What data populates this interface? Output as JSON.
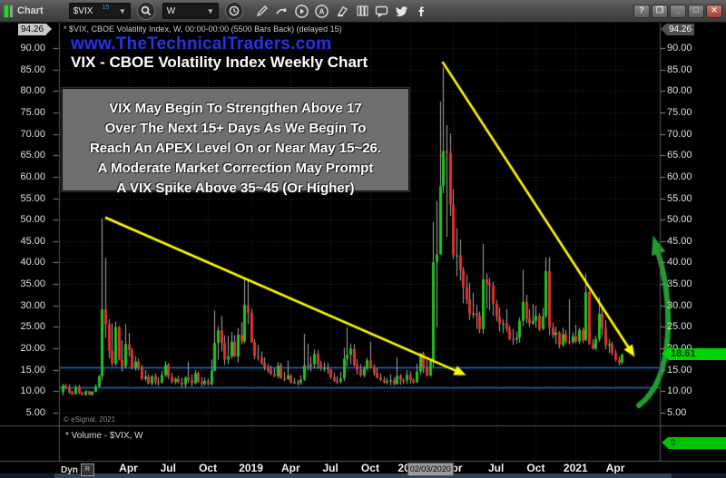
{
  "toolbar": {
    "tab_label": "Chart",
    "symbol_value": "$VIX",
    "symbol_badge": "15",
    "interval_value": "W",
    "window_buttons": {
      "help": "?",
      "minimize": "_",
      "close": "x"
    }
  },
  "chart_header": {
    "info_line": "* $VIX, CBOE Volatility Index, W, 00:00-00:00 (5500 Bars Back) (delayed 15)",
    "link": "www.TheTechnicalTraders.com",
    "title": "VIX - CBOE Volatility Index Weekly Chart"
  },
  "annotation_box": {
    "lines": [
      "VIX May Begin To Strengthen Above 17",
      "Over The Next 15+ Days As We Begin To",
      "Reach An APEX Level On or Near May 15~26.",
      "A Moderate Market Correction May Prompt",
      "A VIX Spike Above 35~45 (Or Higher)"
    ]
  },
  "price_axis": {
    "high_label": "94.26",
    "last_label": "18.61"
  },
  "volume_panel": {
    "label": "* Volume - $VIX, W",
    "last_label": "0"
  },
  "footer": {
    "dyn_label": "Dyn",
    "date_marker": "02/03/2020"
  },
  "copyright": "© eSignal, 2021",
  "chart_data": {
    "type": "candlestick",
    "symbol": "$VIX",
    "interval": "W",
    "title": "VIX - CBOE Volatility Index Weekly Chart",
    "ylim": [
      5,
      90
    ],
    "ytick_step": 5,
    "high_marker": 94.26,
    "last_close": 18.61,
    "grid": true,
    "colors": {
      "up": "#1fc421",
      "down": "#e33030",
      "wick": "#a8a8a8",
      "trendline": "#ffff00",
      "momentum_arrow": "#1f9e2e",
      "support": "#1d6fc0",
      "tag": "#00d400"
    },
    "x_ticks": [
      {
        "label": "Apr",
        "week": 20
      },
      {
        "label": "Jul",
        "week": 32
      },
      {
        "label": "Oct",
        "week": 44
      },
      {
        "label": "2019",
        "week": 57
      },
      {
        "label": "Apr",
        "week": 69
      },
      {
        "label": "Jul",
        "week": 81
      },
      {
        "label": "Oct",
        "week": 93
      },
      {
        "label": "2020",
        "week": 105
      },
      {
        "label": "Apr",
        "week": 118
      },
      {
        "label": "Jul",
        "week": 131
      },
      {
        "label": "Oct",
        "week": 143
      },
      {
        "label": "2021",
        "week": 155
      },
      {
        "label": "Apr",
        "week": 167
      }
    ],
    "date_marker_week": 105,
    "support_lines": [
      {
        "price": 15.6,
        "color": "#1d6fc0"
      },
      {
        "price": 11.0,
        "color": "#1d6fc0"
      }
    ],
    "trendlines": [
      {
        "x1_week": 13.0,
        "p1": 50.5,
        "x2_week": 119.7,
        "p2": 14.5,
        "color": "#ffff00"
      },
      {
        "x1_week": 114.8,
        "p1": 86.8,
        "x2_week": 171.5,
        "p2": 19.6,
        "color": "#ffff00"
      }
    ],
    "green_arrow": {
      "start": [
        704,
        447
      ],
      "c1": [
        745,
        416
      ],
      "c2": [
        741,
        330
      ],
      "end": [
        724,
        274
      ],
      "color": "#1f9e2e"
    },
    "candles": [
      [
        9.8,
        11.7,
        9.0,
        11.3
      ],
      [
        11.3,
        11.8,
        10.4,
        10.7
      ],
      [
        10.7,
        11.6,
        9.4,
        9.7
      ],
      [
        9.7,
        10.1,
        9.1,
        9.3
      ],
      [
        9.3,
        11.4,
        9.2,
        11.0
      ],
      [
        11.0,
        11.5,
        9.3,
        9.6
      ],
      [
        9.6,
        9.9,
        9.0,
        9.2
      ],
      [
        9.2,
        10.2,
        8.9,
        10.0
      ],
      [
        10.0,
        10.1,
        9.0,
        9.2
      ],
      [
        9.2,
        10.0,
        8.9,
        9.9
      ],
      [
        9.9,
        11.6,
        9.8,
        11.1
      ],
      [
        11.1,
        13.8,
        10.9,
        13.5
      ],
      [
        13.5,
        50.3,
        12.5,
        29.1
      ],
      [
        29.1,
        41.1,
        22.4,
        25.6
      ],
      [
        25.6,
        26.8,
        17.7,
        19.5
      ],
      [
        19.5,
        25.8,
        15.9,
        16.5
      ],
      [
        16.5,
        26.2,
        15.9,
        24.9
      ],
      [
        24.9,
        25.3,
        17.2,
        17.4
      ],
      [
        17.4,
        21.9,
        14.6,
        15.8
      ],
      [
        15.8,
        25.7,
        15.3,
        21.0
      ],
      [
        21.0,
        23.6,
        18.1,
        19.6
      ],
      [
        19.6,
        20.1,
        15.1,
        15.4
      ],
      [
        15.4,
        18.2,
        14.8,
        16.9
      ],
      [
        16.9,
        17.6,
        14.9,
        15.4
      ],
      [
        15.4,
        16.2,
        12.6,
        12.9
      ],
      [
        12.9,
        14.9,
        12.4,
        13.4
      ],
      [
        13.4,
        14.0,
        11.6,
        11.8
      ],
      [
        11.8,
        13.8,
        11.3,
        13.5
      ],
      [
        13.5,
        14.1,
        11.5,
        12.2
      ],
      [
        12.2,
        13.3,
        11.2,
        12.0
      ],
      [
        12.0,
        14.7,
        11.8,
        13.8
      ],
      [
        13.8,
        17.0,
        13.3,
        16.1
      ],
      [
        16.1,
        16.6,
        12.9,
        13.4
      ],
      [
        13.4,
        14.3,
        11.8,
        12.2
      ],
      [
        12.2,
        13.2,
        11.6,
        12.9
      ],
      [
        12.9,
        13.6,
        11.9,
        12.1
      ],
      [
        12.1,
        13.2,
        10.9,
        11.6
      ],
      [
        11.6,
        13.5,
        10.8,
        13.2
      ],
      [
        13.2,
        16.9,
        12.0,
        12.6
      ],
      [
        12.6,
        13.9,
        11.1,
        11.9
      ],
      [
        11.9,
        14.9,
        11.6,
        14.2
      ],
      [
        14.2,
        14.6,
        12.1,
        12.1
      ],
      [
        12.1,
        13.3,
        11.1,
        11.7
      ],
      [
        11.7,
        13.2,
        11.3,
        12.4
      ],
      [
        12.4,
        13.0,
        11.3,
        11.6
      ],
      [
        11.6,
        17.4,
        11.3,
        14.8
      ],
      [
        14.8,
        28.8,
        14.6,
        21.3
      ],
      [
        21.3,
        25.2,
        17.3,
        24.2
      ],
      [
        24.2,
        27.5,
        19.3,
        21.3
      ],
      [
        21.3,
        23.0,
        16.1,
        17.4
      ],
      [
        17.4,
        22.9,
        16.3,
        18.1
      ],
      [
        18.1,
        23.8,
        17.6,
        21.5
      ],
      [
        21.5,
        23.1,
        18.0,
        18.1
      ],
      [
        18.1,
        24.7,
        16.7,
        23.2
      ],
      [
        23.2,
        26.1,
        20.9,
        21.6
      ],
      [
        21.6,
        36.2,
        21.2,
        30.1
      ],
      [
        30.1,
        36.1,
        25.6,
        28.3
      ],
      [
        28.3,
        29.2,
        21.4,
        21.4
      ],
      [
        21.4,
        22.1,
        17.5,
        18.2
      ],
      [
        18.2,
        20.8,
        17.1,
        17.8
      ],
      [
        17.8,
        19.3,
        16.2,
        16.6
      ],
      [
        16.6,
        17.9,
        14.9,
        15.7
      ],
      [
        15.7,
        16.4,
        14.3,
        14.9
      ],
      [
        14.9,
        16.0,
        13.7,
        14.0
      ],
      [
        14.0,
        15.4,
        13.3,
        13.5
      ],
      [
        13.5,
        16.9,
        13.0,
        16.0
      ],
      [
        16.0,
        16.6,
        12.9,
        13.0
      ],
      [
        13.0,
        14.5,
        12.3,
        12.9
      ],
      [
        12.9,
        17.1,
        12.6,
        13.7
      ],
      [
        13.7,
        14.0,
        11.8,
        12.0
      ],
      [
        12.0,
        13.1,
        11.7,
        12.1
      ],
      [
        12.1,
        12.7,
        11.3,
        12.0
      ],
      [
        12.0,
        13.7,
        11.5,
        12.7
      ],
      [
        12.7,
        23.4,
        12.4,
        16.0
      ],
      [
        16.0,
        21.1,
        14.9,
        15.9
      ],
      [
        15.9,
        18.1,
        14.6,
        16.3
      ],
      [
        16.3,
        19.7,
        15.3,
        18.7
      ],
      [
        18.7,
        19.6,
        15.2,
        16.3
      ],
      [
        16.3,
        17.1,
        14.8,
        15.4
      ],
      [
        15.4,
        16.7,
        14.5,
        15.4
      ],
      [
        15.4,
        16.6,
        14.0,
        15.1
      ],
      [
        15.1,
        15.2,
        12.8,
        13.3
      ],
      [
        13.3,
        14.3,
        12.2,
        12.4
      ],
      [
        12.4,
        13.5,
        11.7,
        12.2
      ],
      [
        12.2,
        14.5,
        11.8,
        13.0
      ],
      [
        13.0,
        20.1,
        12.4,
        17.6
      ],
      [
        17.6,
        24.8,
        15.8,
        18.5
      ],
      [
        18.5,
        21.1,
        16.3,
        19.9
      ],
      [
        19.9,
        21.0,
        15.8,
        16.1
      ],
      [
        16.1,
        17.5,
        13.9,
        15.0
      ],
      [
        15.0,
        16.3,
        13.3,
        13.7
      ],
      [
        13.7,
        15.9,
        13.2,
        15.3
      ],
      [
        15.3,
        17.8,
        14.9,
        17.2
      ],
      [
        17.2,
        21.5,
        15.4,
        15.7
      ],
      [
        15.7,
        16.3,
        13.6,
        14.2
      ],
      [
        14.2,
        15.4,
        12.9,
        13.2
      ],
      [
        13.2,
        14.1,
        12.3,
        12.6
      ],
      [
        12.6,
        13.4,
        11.8,
        12.1
      ],
      [
        12.1,
        13.1,
        11.6,
        12.3
      ],
      [
        12.3,
        13.9,
        11.4,
        12.6
      ],
      [
        12.6,
        13.2,
        11.3,
        11.7
      ],
      [
        11.7,
        18.0,
        11.5,
        13.6
      ],
      [
        13.6,
        14.0,
        11.5,
        12.6
      ],
      [
        12.6,
        13.0,
        11.7,
        12.5
      ],
      [
        12.5,
        14.9,
        11.7,
        13.8
      ],
      [
        13.8,
        14.6,
        11.8,
        12.6
      ],
      [
        12.6,
        13.0,
        11.7,
        12.1
      ],
      [
        12.1,
        16.4,
        11.9,
        14.6
      ],
      [
        14.6,
        19.0,
        13.9,
        18.8
      ],
      [
        18.8,
        19.2,
        14.2,
        15.5
      ],
      [
        15.5,
        17.3,
        13.4,
        13.7
      ],
      [
        13.7,
        17.1,
        13.4,
        17.1
      ],
      [
        17.1,
        49.5,
        15.6,
        40.1
      ],
      [
        40.1,
        54.4,
        24.9,
        41.9
      ],
      [
        41.9,
        77.6,
        41.8,
        57.8
      ],
      [
        57.8,
        85.5,
        56.1,
        66.0
      ],
      [
        66.0,
        72.0,
        46.0,
        65.5
      ],
      [
        65.5,
        70.0,
        50.9,
        53.5
      ],
      [
        53.5,
        57.1,
        40.8,
        41.7
      ],
      [
        41.7,
        48.0,
        36.8,
        41.7
      ],
      [
        41.7,
        45.4,
        35.8,
        38.2
      ],
      [
        38.2,
        39.0,
        30.5,
        34.2
      ],
      [
        34.2,
        37.2,
        30.3,
        31.4
      ],
      [
        31.4,
        35.3,
        26.6,
        28.0
      ],
      [
        28.0,
        33.0,
        27.0,
        28.2
      ],
      [
        28.2,
        30.1,
        24.5,
        27.5
      ],
      [
        27.5,
        28.6,
        23.5,
        24.5
      ],
      [
        24.5,
        44.4,
        23.3,
        36.1
      ],
      [
        36.1,
        37.5,
        29.3,
        35.1
      ],
      [
        35.1,
        36.4,
        28.9,
        34.7
      ],
      [
        34.7,
        35.5,
        27.6,
        30.4
      ],
      [
        30.4,
        31.3,
        26.3,
        27.3
      ],
      [
        27.3,
        29.5,
        23.9,
        25.7
      ],
      [
        25.7,
        26.8,
        23.5,
        25.8
      ],
      [
        25.8,
        29.2,
        23.8,
        24.5
      ],
      [
        24.5,
        25.3,
        21.9,
        22.2
      ],
      [
        22.2,
        24.5,
        20.8,
        22.1
      ],
      [
        22.1,
        23.9,
        21.1,
        22.5
      ],
      [
        22.5,
        27.2,
        21.3,
        26.4
      ],
      [
        26.4,
        38.3,
        25.2,
        30.8
      ],
      [
        30.8,
        32.5,
        25.9,
        26.9
      ],
      [
        26.9,
        29.1,
        25.0,
        25.8
      ],
      [
        25.8,
        30.3,
        25.4,
        26.4
      ],
      [
        26.4,
        29.9,
        24.9,
        27.6
      ],
      [
        27.6,
        28.2,
        24.0,
        24.5
      ],
      [
        24.5,
        29.4,
        24.2,
        27.5
      ],
      [
        27.5,
        41.2,
        27.1,
        38.0
      ],
      [
        38.0,
        41.2,
        23.1,
        24.9
      ],
      [
        24.9,
        26.1,
        22.4,
        23.1
      ],
      [
        23.1,
        25.1,
        21.0,
        23.7
      ],
      [
        23.7,
        24.0,
        20.0,
        20.8
      ],
      [
        20.8,
        24.8,
        20.3,
        23.3
      ],
      [
        23.3,
        24.3,
        21.1,
        21.6
      ],
      [
        21.6,
        31.5,
        20.9,
        21.5
      ],
      [
        21.5,
        23.7,
        21.0,
        22.8
      ],
      [
        22.8,
        25.5,
        21.2,
        21.6
      ],
      [
        21.6,
        24.8,
        21.0,
        24.3
      ],
      [
        24.3,
        24.8,
        21.2,
        21.9
      ],
      [
        21.9,
        37.5,
        21.7,
        33.1
      ],
      [
        33.1,
        33.4,
        20.9,
        21.0
      ],
      [
        21.0,
        22.1,
        19.7,
        20.0
      ],
      [
        20.0,
        22.9,
        19.5,
        22.1
      ],
      [
        22.1,
        31.9,
        21.5,
        28.0
      ],
      [
        28.0,
        30.0,
        23.0,
        24.7
      ],
      [
        24.7,
        26.6,
        19.8,
        20.7
      ],
      [
        20.7,
        22.1,
        18.9,
        21.0
      ],
      [
        21.0,
        21.6,
        18.3,
        18.9
      ],
      [
        18.9,
        19.6,
        16.9,
        17.3
      ],
      [
        17.3,
        18.1,
        16.0,
        16.7
      ],
      [
        16.7,
        18.7,
        16.2,
        18.6
      ]
    ]
  }
}
